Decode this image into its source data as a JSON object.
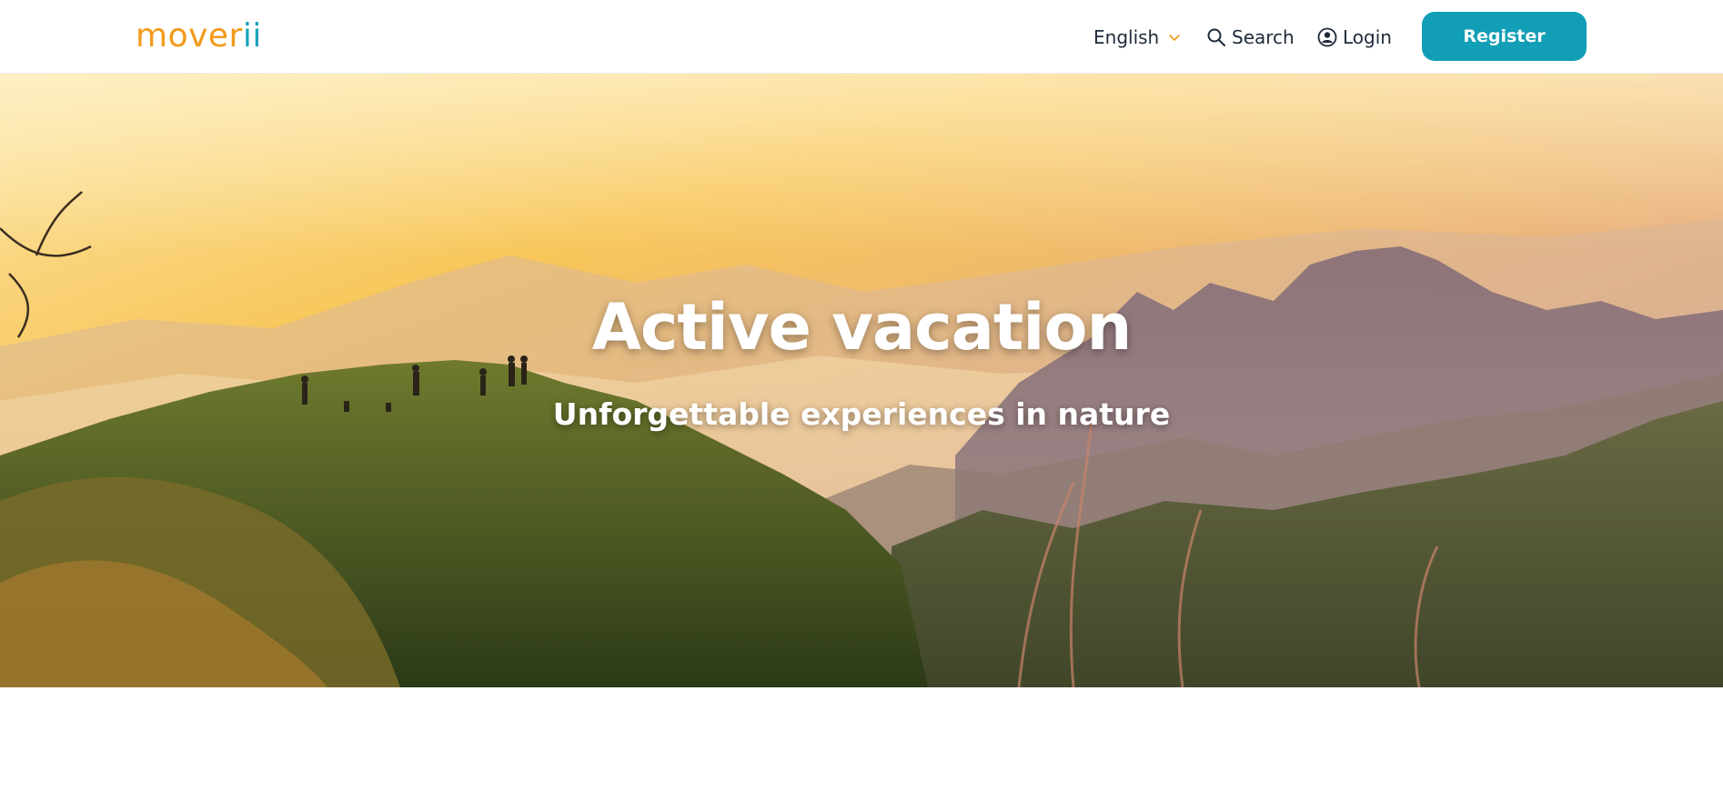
{
  "header": {
    "logo": {
      "main": "mover",
      "accent": "ii"
    },
    "language": {
      "label": "English",
      "icon": "chevron-down-icon"
    },
    "search": {
      "label": "Search",
      "icon": "search-icon"
    },
    "login": {
      "label": "Login",
      "icon": "user-circle-icon"
    },
    "register_label": "Register"
  },
  "hero": {
    "title": "Active vacation",
    "subtitle": "Unforgettable experiences in nature"
  },
  "colors": {
    "brand_orange": "#f39a1a",
    "brand_teal": "#129eb6",
    "text_dark": "#1e2a3a"
  }
}
